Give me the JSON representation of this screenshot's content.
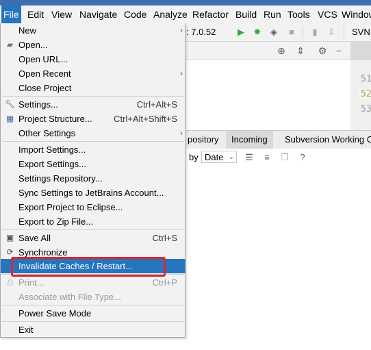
{
  "menubar": {
    "items": [
      "File",
      "Edit",
      "View",
      "Navigate",
      "Code",
      "Analyze",
      "Refactor",
      "Build",
      "Run",
      "Tools",
      "VCS",
      "Window"
    ]
  },
  "toolbar": {
    "version": ": 7.0.52",
    "svn": "SVN:"
  },
  "gutter": {
    "lines": [
      "51",
      "52",
      "53"
    ]
  },
  "vcs_panel": {
    "tabs": [
      "pository",
      "Incoming",
      "Subversion Working C"
    ],
    "group_by_label": "by",
    "group_by_value": "Date",
    "help": "?"
  },
  "file_menu": {
    "items": [
      {
        "label": "New",
        "shortcut": "",
        "submenu": true
      },
      {
        "label": "Open...",
        "shortcut": "",
        "icon": "folder-open-icon"
      },
      {
        "label": "Open URL...",
        "shortcut": ""
      },
      {
        "label": "Open Recent",
        "shortcut": "",
        "submenu": true
      },
      {
        "label": "Close Project",
        "shortcut": ""
      },
      {
        "label": "Settings...",
        "shortcut": "Ctrl+Alt+S",
        "icon": "wrench-icon"
      },
      {
        "label": "Project Structure...",
        "shortcut": "Ctrl+Alt+Shift+S",
        "icon": "project-structure-icon"
      },
      {
        "label": "Other Settings",
        "shortcut": "",
        "submenu": true
      },
      {
        "label": "Import Settings...",
        "shortcut": ""
      },
      {
        "label": "Export Settings...",
        "shortcut": ""
      },
      {
        "label": "Settings Repository...",
        "shortcut": ""
      },
      {
        "label": "Sync Settings to JetBrains Account...",
        "shortcut": ""
      },
      {
        "label": "Export Project to Eclipse...",
        "shortcut": ""
      },
      {
        "label": "Export to Zip File...",
        "shortcut": ""
      },
      {
        "label": "Save All",
        "shortcut": "Ctrl+S",
        "icon": "save-icon"
      },
      {
        "label": "Synchronize",
        "shortcut": "",
        "icon": "refresh-icon"
      },
      {
        "label": "Invalidate Caches / Restart...",
        "shortcut": "",
        "selected": true
      },
      {
        "label": "Print...",
        "shortcut": "Ctrl+P",
        "disabled": true,
        "icon": "print-icon"
      },
      {
        "label": "Associate with File Type...",
        "shortcut": "",
        "disabled": true
      },
      {
        "label": "Power Save Mode",
        "shortcut": ""
      },
      {
        "label": "Exit",
        "shortcut": ""
      }
    ]
  },
  "colors": {
    "selection": "#2675bf",
    "annotation_box": "#e0252b",
    "run_green": "#3aa53a"
  }
}
